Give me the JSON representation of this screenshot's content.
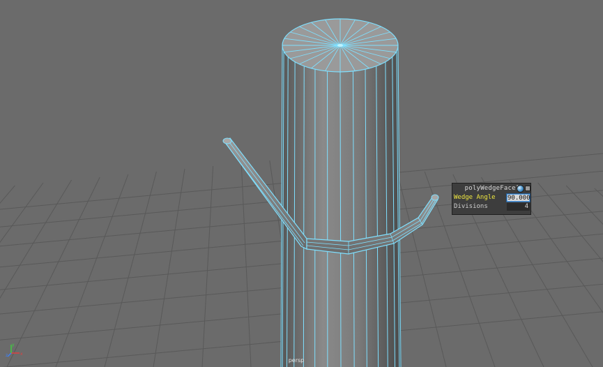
{
  "viewport": {
    "camera": "persp",
    "background_color": "#6b6b6b",
    "grid_color": "#555555",
    "wireframe_color": "#7fe0ff"
  },
  "hud": {
    "title": "polyWedgeFace1",
    "icons": [
      "help-icon",
      "close-icon"
    ],
    "attributes": [
      {
        "label": "Wedge Angle",
        "value": "90.000",
        "active": true
      },
      {
        "label": "Divisions",
        "value": "4",
        "active": false
      }
    ]
  },
  "axis_gizmo": {
    "labels": [
      "x",
      "y",
      "z"
    ]
  }
}
